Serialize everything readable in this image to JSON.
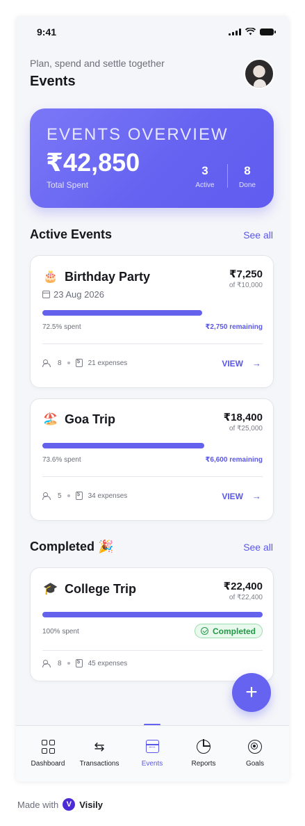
{
  "status_bar": {
    "time": "9:41"
  },
  "header": {
    "subtitle": "Plan, spend and settle together",
    "title": "Events",
    "avatar": "user-avatar"
  },
  "overview": {
    "title": "EVENTS OVERVIEW",
    "amount": "₹42,850",
    "amount_label": "Total Spent",
    "active_count": "3",
    "active_label": "Active",
    "done_count": "8",
    "done_label": "Done"
  },
  "active_section": {
    "title": "Active Events",
    "see_all": "See all"
  },
  "active_events": [
    {
      "emoji": "🎂",
      "name": "Birthday Party",
      "amount": "₹7,250",
      "of": "of ₹10,000",
      "date": "23 Aug 2026",
      "progress": 0.725,
      "spent": "72.5% spent",
      "remaining": "₹2,750 remaining",
      "members": "8",
      "expenses": "21 expenses",
      "action": "VIEW"
    },
    {
      "emoji": "🏖️",
      "name": "Goa Trip",
      "amount": "₹18,400",
      "of": "of ₹25,000",
      "progress": 0.736,
      "spent": "73.6% spent",
      "remaining": "₹6,600 remaining",
      "members": "5",
      "expenses": "34 expenses",
      "action": "VIEW"
    }
  ],
  "completed_section": {
    "title": "Completed 🎉",
    "see_all": "See all"
  },
  "completed_events": [
    {
      "emoji": "🎓",
      "name": "College Trip",
      "amount": "₹22,400",
      "of": "of ₹22,400",
      "progress": 1.0,
      "spent": "100% spent",
      "badge": "Completed",
      "members": "8",
      "expenses": "45 expenses"
    }
  ],
  "fab": {
    "label": "+"
  },
  "nav": {
    "items": [
      {
        "label": "Dashboard",
        "icon": "dashboard-icon"
      },
      {
        "label": "Transactions",
        "icon": "transactions-icon"
      },
      {
        "label": "Events",
        "icon": "calendar-icon",
        "active": true
      },
      {
        "label": "Reports",
        "icon": "pie-chart-icon"
      },
      {
        "label": "Goals",
        "icon": "target-icon"
      }
    ]
  },
  "footer": {
    "made_with": "Made with",
    "brand": "Visily",
    "brand_initial": "V"
  },
  "colors": {
    "accent": "#6663f1",
    "success": "#1f9a45"
  }
}
